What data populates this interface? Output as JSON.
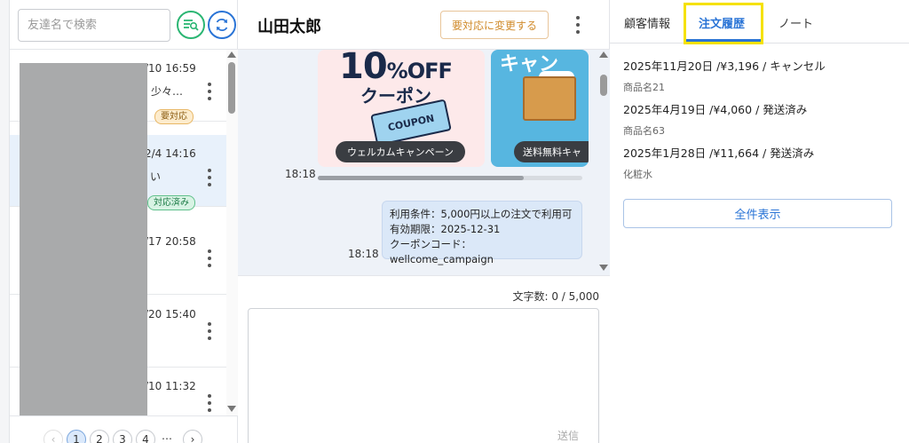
{
  "left": {
    "search_placeholder": "友達名で検索",
    "friends": [
      {
        "time": "/10 16:59",
        "message": "少々…",
        "badge": "要対応",
        "badge_type": "warn"
      },
      {
        "time": "2/4 14:16",
        "message": "い",
        "badge": "対応済み",
        "badge_type": "done"
      },
      {
        "time": "/17 20:58",
        "message": "",
        "badge": "",
        "badge_type": ""
      },
      {
        "time": "/20 15:40",
        "message": "",
        "badge": "",
        "badge_type": ""
      },
      {
        "time": "/10 11:32",
        "message": "",
        "badge": "",
        "badge_type": ""
      }
    ],
    "pagination": {
      "pages": [
        "1",
        "2",
        "3",
        "4"
      ],
      "prev": "‹",
      "next": "›",
      "ellipsis": "…"
    }
  },
  "center": {
    "chat_name": "山田太郎",
    "status_button": "要対応に変更する",
    "card1": {
      "headline_num": "10",
      "headline_pct": "%OFF",
      "coupon_text": "クーポン",
      "ticket_text": "COUPON",
      "label": "ウェルカムキャンペーン"
    },
    "card2": {
      "headline": "キャン",
      "label": "送料無料キャ"
    },
    "time1": "18:18",
    "bubble_lines": [
      "利用条件：5,000円以上の注文で利用可",
      "有効期限：2025-12-31",
      "クーポンコード：wellcome_campaign"
    ],
    "time2": "18:18",
    "char_count": "文字数: 0 / 5,000",
    "send_label": "送信"
  },
  "right": {
    "tabs": [
      "顧客情報",
      "注文履歴",
      "ノート"
    ],
    "orders": [
      {
        "main": "2025年11月20日 /¥3,196 / キャンセル",
        "item": "商品名21"
      },
      {
        "main": "2025年4月19日 /¥4,060 / 発送済み",
        "item": "商品名63"
      },
      {
        "main": "2025年1月28日 /¥11,664 / 発送済み",
        "item": "化粧水"
      }
    ],
    "show_all": "全件表示"
  },
  "colors": {
    "accent": "#2a74d6",
    "green": "#2bb673",
    "highlight": "#f5e100",
    "warn": "#d08a2a"
  }
}
